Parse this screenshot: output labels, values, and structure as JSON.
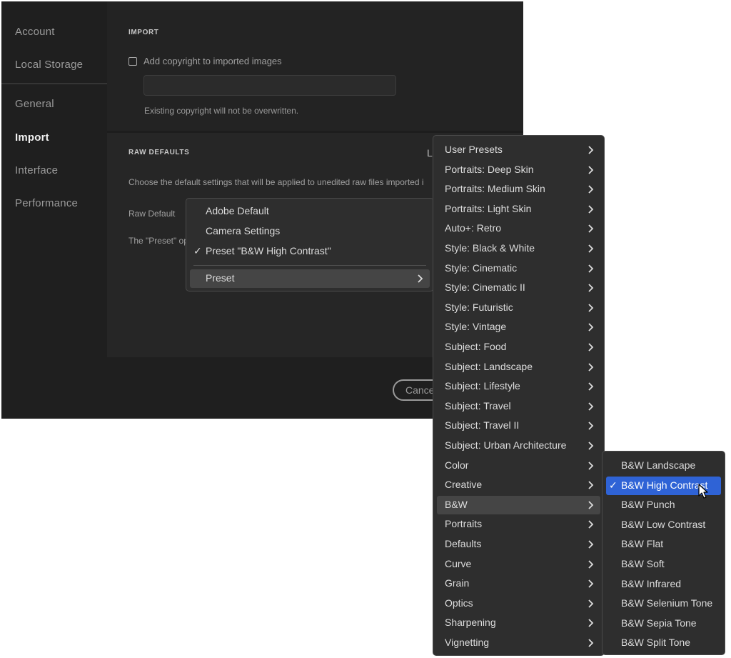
{
  "sidebar": {
    "items": [
      {
        "label": "Account"
      },
      {
        "label": "Local Storage"
      },
      {
        "label": "General"
      },
      {
        "label": "Import"
      },
      {
        "label": "Interface"
      },
      {
        "label": "Performance"
      }
    ]
  },
  "import_section": {
    "heading": "IMPORT",
    "copyright_checkbox_label": "Add copyright to imported images",
    "copyright_value": "",
    "hint": "Existing copyright will not be overwritten."
  },
  "raw_section": {
    "heading": "RAW DEFAULTS",
    "heading_right_fragment": "L",
    "description": "Choose the default settings that will be applied to unedited raw files imported i",
    "raw_default_label": "Raw Default",
    "preset_note": "The \"Preset\" op"
  },
  "footer": {
    "cancel_label": "Cance"
  },
  "raw_default_menu": {
    "items": [
      {
        "label": "Adobe Default",
        "checked": false
      },
      {
        "label": "Camera Settings",
        "checked": false
      },
      {
        "label": "Preset \"B&W High Contrast\"",
        "checked": true
      }
    ],
    "submenu_item": {
      "label": "Preset"
    }
  },
  "preset_groups_menu": {
    "items": [
      "User Presets",
      "Portraits: Deep Skin",
      "Portraits: Medium Skin",
      "Portraits: Light Skin",
      "Auto+: Retro",
      "Style: Black & White",
      "Style: Cinematic",
      "Style: Cinematic II",
      "Style: Futuristic",
      "Style: Vintage",
      "Subject: Food",
      "Subject: Landscape",
      "Subject: Lifestyle",
      "Subject: Travel",
      "Subject: Travel II",
      "Subject: Urban Architecture",
      "Color",
      "Creative",
      "B&W",
      "Portraits",
      "Defaults",
      "Curve",
      "Grain",
      "Optics",
      "Sharpening",
      "Vignetting"
    ],
    "highlighted": "B&W"
  },
  "bw_menu": {
    "items": [
      "B&W Landscape",
      "B&W High Contrast",
      "B&W Punch",
      "B&W Low Contrast",
      "B&W Flat",
      "B&W Soft",
      "B&W Infrared",
      "B&W Selenium Tone",
      "B&W Sepia Tone",
      "B&W Split Tone"
    ],
    "selected": "B&W High Contrast"
  },
  "colors": {
    "accent": "#2f63d6",
    "window_bg": "#1f1f1f",
    "menu_bg": "#2e2e2e"
  },
  "icons": {
    "submenu_arrow": "chevron-right-icon",
    "checkmark": "checkmark-icon",
    "cursor": "mouse-pointer-icon"
  }
}
